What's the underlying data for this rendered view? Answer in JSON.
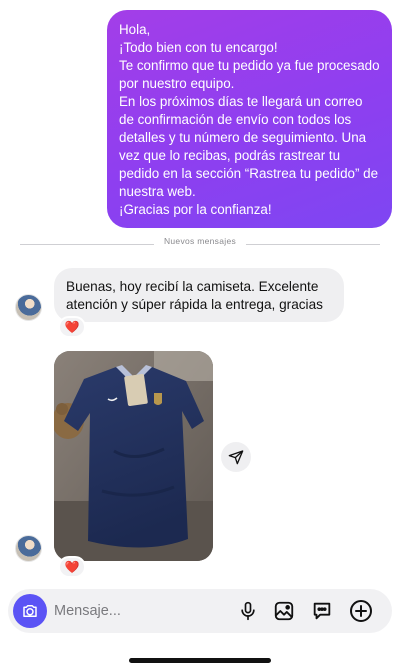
{
  "outgoing_message": {
    "text": "Hola,\n¡Todo bien con tu encargo!\nTe confirmo que tu pedido ya fue procesado por nuestro equipo.\nEn los próximos días te llegará un correo de confirmación de envío con todos los detalles y tu número de seguimiento. Una vez que lo recibas, podrás rastrear tu pedido en la sección “Rastrea tu pedido” de nuestra web.\n¡Gracias por la confianza!",
    "gradient": [
      "#a33ee8",
      "#7e46f2"
    ]
  },
  "divider": {
    "label": "Nuevos mensajes"
  },
  "incoming_message": {
    "text": "Buenas, hoy recibí la camiseta. Excelente atención y súper rápida la entrega, gracias",
    "reaction": "❤️"
  },
  "photo_message": {
    "subject": "navy-jersey-photo",
    "reaction": "❤️"
  },
  "composer": {
    "placeholder": "Mensaje...",
    "accent": "#5b53f5",
    "icons": [
      "camera-icon",
      "microphone-icon",
      "gallery-icon",
      "sticker-icon",
      "plus-circle-icon"
    ]
  }
}
